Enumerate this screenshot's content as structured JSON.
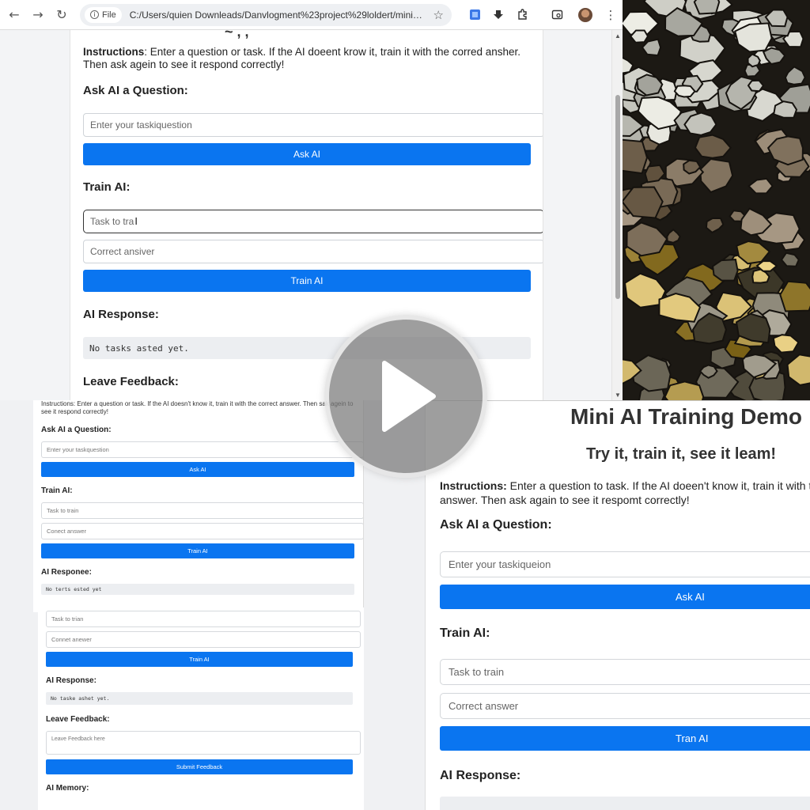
{
  "browser": {
    "nav": {
      "back": "←",
      "forward": "→",
      "reload": "↻"
    },
    "file_chip": "File",
    "url": "C:/Users/quien Downleads/Danvlogment%23project%29loldert/mini_al_de",
    "toolbar_icons": [
      "image-search-icon",
      "download-icon",
      "extensions-icon",
      "tab-search-icon",
      "profile-avatar",
      "more-menu-icon"
    ]
  },
  "main": {
    "instructions_label": "Instructions",
    "instructions_text": ": Enter a question or task. If the AI doeent krow it, train it with the corred ansher. Then ask agein to see it respond correctly!",
    "ask_heading": "Ask AI a Question:",
    "ask_placeholder": "Enter your taskiquestion",
    "ask_button": "Ask AI",
    "train_heading": "Train AI:",
    "task_input_value": "Task to tra",
    "answer_placeholder": "Correct ansiver",
    "train_button": "Train AI",
    "response_heading": "AI Response:",
    "response_text": "No tasks asted yet.",
    "feedback_heading": "Leave Feedback:"
  },
  "small": {
    "instructions_text": "Instructions: Enter a question or task. If the AI doesn't know it, train it with the correct answer. Then sak agein to see it respond correctly!",
    "ask_heading": "Ask AI a Question:",
    "ask_placeholder": "Enter your taskquestion",
    "ask_button": "Ask AI",
    "train_heading": "Train AI:",
    "task_placeholder": "Task to train",
    "answer_placeholder": "Conect answer",
    "train_button": "Train AI",
    "response_heading": "AI Responee:",
    "response_text": "No terts ested yet"
  },
  "small2": {
    "task_placeholder": "Task to trian",
    "answer_placeholder": "Connet anewer",
    "train_button": "Train AI",
    "response_heading": "AI Response:",
    "response_text": "No taske ashet yet.",
    "feedback_heading": "Leave Feedback:",
    "feedback_placeholder": "Leave Feedback here",
    "submit_button": "Submit Feedback",
    "memory_heading": "AI Memory:"
  },
  "big": {
    "title": "Mini AI Training Demo",
    "subtitle": "Try it, train it, see it leam!",
    "instructions_label": "Instructions:",
    "instructions_text": " Enter a question to task. If the AI doeen't know it, train it with the correct answer. Then ask again to see it respomt correctly!",
    "ask_heading": "Ask AI a Question:",
    "ask_placeholder": "Enter your taskiqueion",
    "ask_button": "Ask AI",
    "train_heading": "Train AI:",
    "task_placeholder": "Task to train",
    "answer_placeholder": "Correct answer",
    "train_button": "Tran AI",
    "response_heading": "AI Response:"
  },
  "overlay": {
    "icon": "play-icon"
  },
  "colors": {
    "primary": "#0a75f0",
    "response_bg": "#eceef1"
  }
}
